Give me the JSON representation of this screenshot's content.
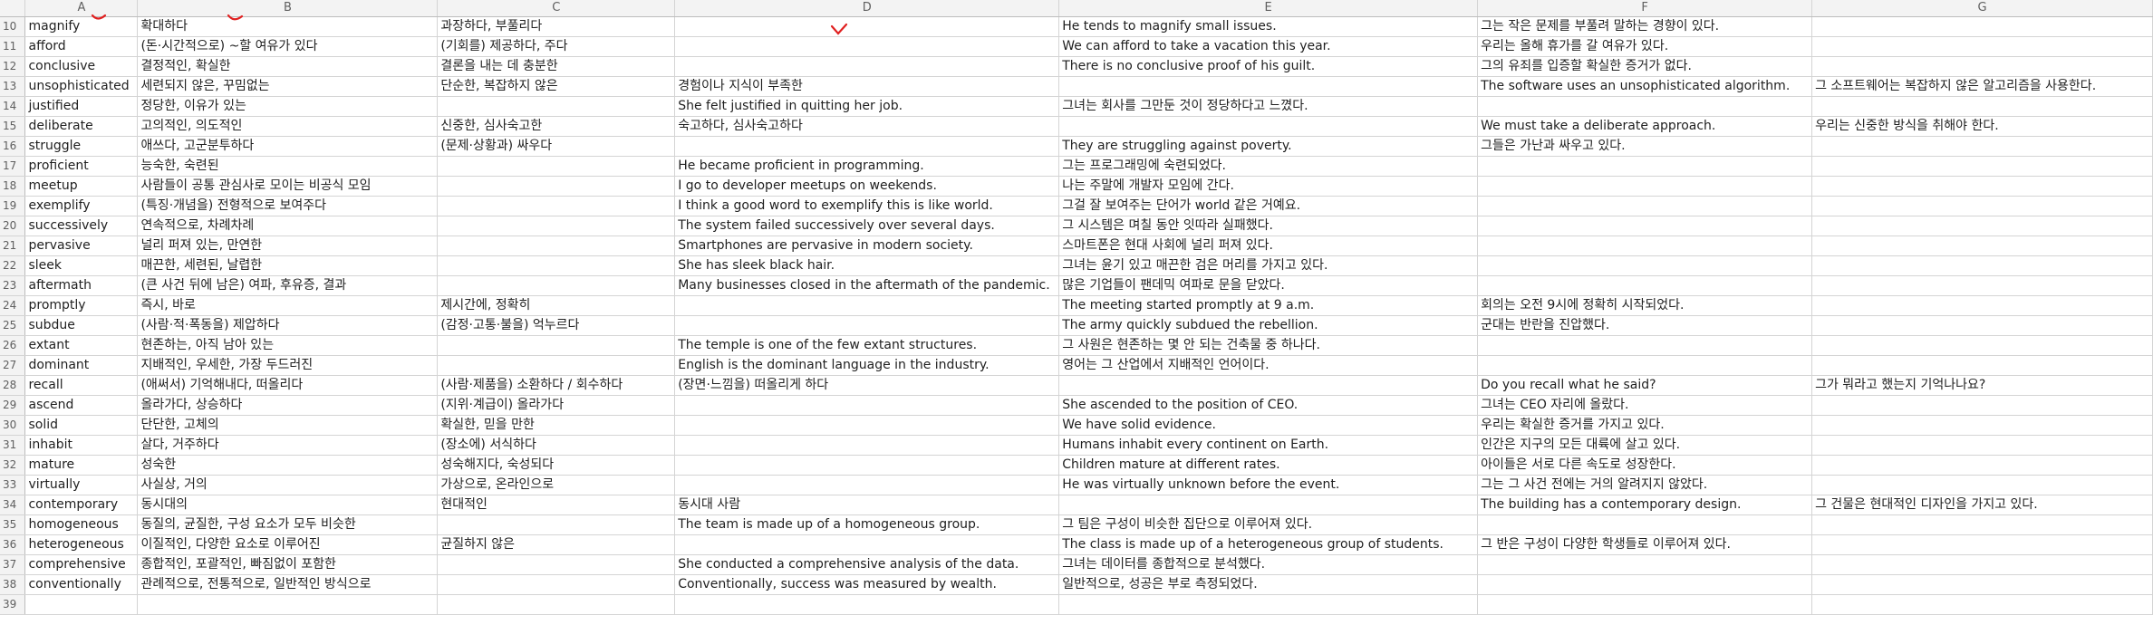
{
  "columns": [
    "A",
    "B",
    "C",
    "D",
    "E",
    "F",
    "G"
  ],
  "rows": [
    {
      "n": "10",
      "a": "magnify",
      "b": "확대하다",
      "c": "과장하다, 부풀리다",
      "d": "",
      "e": "He tends to magnify small issues.",
      "f": "그는 작은 문제를 부풀려 말하는 경향이 있다.",
      "g": ""
    },
    {
      "n": "11",
      "a": "afford",
      "b": "(돈·시간적으로) ~할 여유가 있다",
      "c": "(기회를) 제공하다, 주다",
      "d": "",
      "e": "We can afford to take a vacation this year.",
      "f": "우리는 올해 휴가를 갈 여유가 있다.",
      "g": ""
    },
    {
      "n": "12",
      "a": "conclusive",
      "b": "결정적인, 확실한",
      "c": "결론을 내는 데 충분한",
      "d": "",
      "e": "There is no conclusive proof of his guilt.",
      "f": "그의 유죄를 입증할 확실한 증거가 없다.",
      "g": ""
    },
    {
      "n": "13",
      "a": "unsophisticated",
      "b": "세련되지 않은, 꾸밈없는",
      "c": "단순한, 복잡하지 않은",
      "d": "경험이나 지식이 부족한",
      "e": "",
      "f": "The software uses an unsophisticated algorithm.",
      "g": "그 소프트웨어는 복잡하지 않은 알고리즘을 사용한다."
    },
    {
      "n": "14",
      "a": "justified",
      "b": "정당한, 이유가 있는",
      "c": "",
      "d": "She felt justified in quitting her job.",
      "e": "그녀는 회사를 그만둔 것이 정당하다고 느꼈다.",
      "f": "",
      "g": ""
    },
    {
      "n": "15",
      "a": "deliberate",
      "b": "고의적인, 의도적인",
      "c": "신중한, 심사숙고한",
      "d": "숙고하다, 심사숙고하다",
      "e": "",
      "f": "We must take a deliberate approach.",
      "g": "우리는 신중한 방식을 취해야 한다."
    },
    {
      "n": "16",
      "a": "struggle",
      "b": "애쓰다, 고군분투하다",
      "c": "(문제·상황과) 싸우다",
      "d": "",
      "e": "They are struggling against poverty.",
      "f": "그들은 가난과 싸우고 있다.",
      "g": ""
    },
    {
      "n": "17",
      "a": "proficient",
      "b": "능숙한, 숙련된",
      "c": "",
      "d": "He became proficient in programming.",
      "e": "그는 프로그래밍에 숙련되었다.",
      "f": "",
      "g": ""
    },
    {
      "n": "18",
      "a": "meetup",
      "b": "사람들이 공통 관심사로 모이는 비공식 모임",
      "c": "",
      "d": "I go to developer meetups on weekends.",
      "e": "나는 주말에 개발자 모임에 간다.",
      "f": "",
      "g": ""
    },
    {
      "n": "19",
      "a": "exemplify",
      "b": "(특징·개념을) 전형적으로 보여주다",
      "c": "",
      "d": "I think a good word to exemplify this is like world.",
      "e": "그걸 잘 보여주는 단어가 world 같은 거예요.",
      "f": "",
      "g": ""
    },
    {
      "n": "20",
      "a": "successively",
      "b": "연속적으로, 차례차례",
      "c": "",
      "d": "The system failed successively over several days.",
      "e": "그 시스템은 며칠 동안 잇따라 실패했다.",
      "f": "",
      "g": ""
    },
    {
      "n": "21",
      "a": "pervasive",
      "b": "널리 퍼져 있는, 만연한",
      "c": "",
      "d": "Smartphones are pervasive in modern society.",
      "e": "스마트폰은 현대 사회에 널리 퍼져 있다.",
      "f": "",
      "g": ""
    },
    {
      "n": "22",
      "a": "sleek",
      "b": "매끈한, 세련된, 날렵한",
      "c": "",
      "d": "She has sleek black hair.",
      "e": "그녀는 윤기 있고 매끈한 검은 머리를 가지고 있다.",
      "f": "",
      "g": ""
    },
    {
      "n": "23",
      "a": "aftermath",
      "b": "(큰 사건 뒤에 남은) 여파, 후유증, 결과",
      "c": "",
      "d": "Many businesses closed in the aftermath of the pandemic.",
      "e": "많은 기업들이 팬데믹 여파로 문을 닫았다.",
      "f": "",
      "g": ""
    },
    {
      "n": "24",
      "a": "promptly",
      "b": "즉시, 바로",
      "c": "제시간에, 정확히",
      "d": "",
      "e": "The meeting started promptly at 9 a.m.",
      "f": "회의는 오전 9시에 정확히 시작되었다.",
      "g": ""
    },
    {
      "n": "25",
      "a": "subdue",
      "b": "(사람·적·폭동을) 제압하다",
      "c": "(감정·고통·불을) 억누르다",
      "d": "",
      "e": "The army quickly subdued the rebellion.",
      "f": "군대는 반란을 진압했다.",
      "g": ""
    },
    {
      "n": "26",
      "a": "extant",
      "b": "현존하는, 아직 남아 있는",
      "c": "",
      "d": "The temple is one of the few extant structures.",
      "e": "그 사원은 현존하는 몇 안 되는 건축물 중 하나다.",
      "f": "",
      "g": ""
    },
    {
      "n": "27",
      "a": "dominant",
      "b": "지배적인, 우세한, 가장 두드러진",
      "c": "",
      "d": "English is the dominant language in the industry.",
      "e": "영어는 그 산업에서 지배적인 언어이다.",
      "f": "",
      "g": ""
    },
    {
      "n": "28",
      "a": "recall",
      "b": "(애써서) 기억해내다, 떠올리다",
      "c": "(사람·제품을) 소환하다 / 회수하다",
      "d": "(장면·느낌을) 떠올리게 하다",
      "e": "",
      "f": "Do you recall what he said?",
      "g": "그가 뭐라고 했는지 기억나나요?"
    },
    {
      "n": "29",
      "a": "ascend",
      "b": "올라가다, 상승하다",
      "c": "(지위·계급이) 올라가다",
      "d": "",
      "e": "She ascended to the position of CEO.",
      "f": "그녀는 CEO 자리에 올랐다.",
      "g": ""
    },
    {
      "n": "30",
      "a": "solid",
      "b": "단단한, 고체의",
      "c": "확실한, 믿을 만한",
      "d": "",
      "e": "We have solid evidence.",
      "f": "우리는 확실한 증거를 가지고 있다.",
      "g": ""
    },
    {
      "n": "31",
      "a": "inhabit",
      "b": "살다, 거주하다",
      "c": "(장소에) 서식하다",
      "d": "",
      "e": "Humans inhabit every continent on Earth.",
      "f": "인간은 지구의 모든 대륙에 살고 있다.",
      "g": ""
    },
    {
      "n": "32",
      "a": "mature",
      "b": "성숙한",
      "c": "성숙해지다, 숙성되다",
      "d": "",
      "e": "Children mature at different rates.",
      "f": "아이들은 서로 다른 속도로 성장한다.",
      "g": ""
    },
    {
      "n": "33",
      "a": "virtually",
      "b": "사실상, 거의",
      "c": "가상으로, 온라인으로",
      "d": "",
      "e": "He was virtually unknown before the event.",
      "f": "그는 그 사건 전에는 거의 알려지지 않았다.",
      "g": ""
    },
    {
      "n": "34",
      "a": "contemporary",
      "b": "동시대의",
      "c": "현대적인",
      "d": "동시대 사람",
      "e": "",
      "f": "The building has a contemporary design.",
      "g": "그 건물은 현대적인 디자인을 가지고 있다."
    },
    {
      "n": "35",
      "a": "homogeneous",
      "b": "동질의, 균질한, 구성 요소가 모두 비슷한",
      "c": "",
      "d": "The team is made up of a homogeneous group.",
      "e": "그 팀은 구성이 비슷한 집단으로 이루어져 있다.",
      "f": "",
      "g": ""
    },
    {
      "n": "36",
      "a": "heterogeneous",
      "b": "이질적인, 다양한 요소로 이루어진",
      "c": "균질하지 않은",
      "d": "",
      "e": "The class is made up of a heterogeneous group of students.",
      "f": "그 반은 구성이 다양한 학생들로 이루어져 있다.",
      "g": ""
    },
    {
      "n": "37",
      "a": "comprehensive",
      "b": "종합적인, 포괄적인, 빠짐없이 포함한",
      "c": "",
      "d": "She conducted a comprehensive analysis of the data.",
      "e": "그녀는 데이터를 종합적으로 분석했다.",
      "f": "",
      "g": ""
    },
    {
      "n": "38",
      "a": "conventionally",
      "b": "관례적으로, 전통적으로, 일반적인 방식으로",
      "c": "",
      "d": "Conventionally, success was measured by wealth.",
      "e": "일반적으로, 성공은 부로 측정되었다.",
      "f": "",
      "g": ""
    },
    {
      "n": "39",
      "a": "",
      "b": "",
      "c": "",
      "d": "",
      "e": "",
      "f": "",
      "g": ""
    }
  ],
  "annotations": {
    "marks": [
      "red-pen-mark",
      "red-pen-mark",
      "red-pen-mark"
    ],
    "color": "#e02020"
  }
}
